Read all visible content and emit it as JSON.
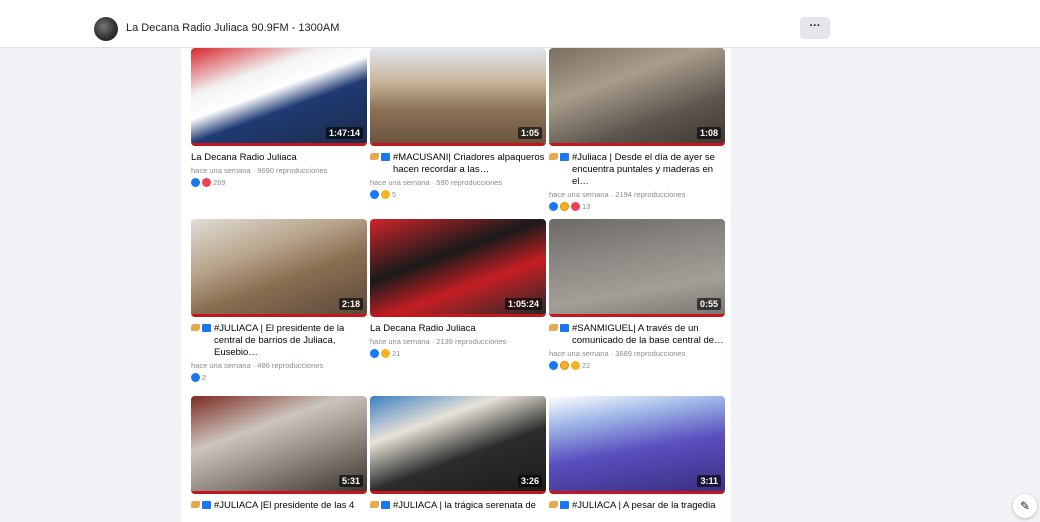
{
  "header": {
    "page_name": "La Decana Radio Juliaca 90.9FM - 1300AM",
    "more_label": "···"
  },
  "videos": [
    {
      "title": "La Decana Radio Juliaca",
      "prefixed": false,
      "meta": "hace una semana · 9690 reproducciones",
      "reactions": [
        "like",
        "love"
      ],
      "count": "269",
      "duration": "1:47:14",
      "scene": "studio-red"
    },
    {
      "title": "#MACUSANI| Criadores alpaqueros hacen recordar a las…",
      "prefixed": true,
      "meta": "hace una semana · 590 reproducciones",
      "reactions": [
        "like",
        "haha"
      ],
      "count": "5",
      "duration": "1:05",
      "scene": "field"
    },
    {
      "title": "#Juliaca | Desde el día de ayer se encuentra puntales y maderas en el…",
      "prefixed": true,
      "meta": "hace una semana · 2194 reproducciones",
      "reactions": [
        "like",
        "wow",
        "love"
      ],
      "count": "13",
      "duration": "1:08",
      "scene": "construction"
    },
    {
      "title": "#JULIACA | El presidente de la central de barrios de Juliaca, Eusebio…",
      "prefixed": true,
      "meta": "hace una semana · 486 reproducciones",
      "reactions": [
        "like"
      ],
      "count": "2",
      "duration": "2:18",
      "scene": "street"
    },
    {
      "title": "La Decana Radio Juliaca",
      "prefixed": false,
      "meta": "hace una semana · 2139 reproducciones",
      "reactions": [
        "like",
        "haha"
      ],
      "count": "21",
      "duration": "1:05:24",
      "scene": "studio-dark"
    },
    {
      "title": "#SANMIGUEL| A través de un comunicado de la base central de…",
      "prefixed": true,
      "meta": "hace una semana · 3689 reproducciones",
      "reactions": [
        "like",
        "wow",
        "sad"
      ],
      "count": "22",
      "duration": "0:55",
      "scene": "mud"
    },
    {
      "title": "#JULIACA |El presidente de las 4",
      "prefixed": true,
      "meta": "",
      "reactions": [],
      "count": "",
      "duration": "5:31",
      "scene": "man-bars"
    },
    {
      "title": "#JULIACA | la trágica serenata de",
      "prefixed": true,
      "meta": "",
      "reactions": [],
      "count": "",
      "duration": "3:26",
      "scene": "man-glasses"
    },
    {
      "title": "#JULIACA | A pesar de la tragedia",
      "prefixed": true,
      "meta": "",
      "reactions": [],
      "count": "",
      "duration": "3:11",
      "scene": "crowd-blue"
    }
  ],
  "colors": {
    "accent_red": "#c4161c",
    "facebook_blue": "#1877f2",
    "page_background": "#f0f2f5"
  },
  "icons": {
    "edit_fab": "compose-icon"
  }
}
